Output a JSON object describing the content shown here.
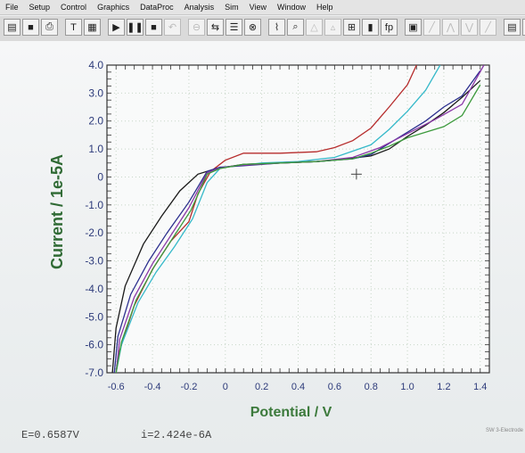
{
  "menu": [
    "File",
    "Setup",
    "Control",
    "Graphics",
    "DataProc",
    "Analysis",
    "Sim",
    "View",
    "Window",
    "Help"
  ],
  "toolbar": {
    "icons": [
      "open-icon",
      "save-icon",
      "print-icon",
      "text-icon",
      "table-icon",
      "run-icon",
      "pause-icon",
      "stop-icon",
      "reverse-icon",
      "filter-icon",
      "transfer-icon",
      "options-icon",
      "smooth-icon",
      "graph-icon",
      "zoom-icon",
      "peak-icon",
      "peak2-icon",
      "overlay-icon",
      "color-icon",
      "fp-label-icon",
      "layout-icon",
      "fit1-icon",
      "fit2-icon",
      "fit3-icon",
      "fit4-icon",
      "report-icon",
      "help-icon"
    ],
    "fp_label": "fp"
  },
  "status": {
    "potential_label": "E=0.6587V",
    "current_label": "i=2.424e-6A"
  },
  "corner_text": "SW   3-Electrode",
  "chart_data": {
    "type": "line",
    "xlabel": "Potential / V",
    "ylabel": "Current / 1e-5A",
    "xlim": [
      -0.65,
      1.45
    ],
    "ylim": [
      -7.0,
      4.0
    ],
    "xticks": [
      "-0.6",
      "-0.4",
      "-0.2",
      "0",
      "0.2",
      "0.4",
      "0.6",
      "0.8",
      "1.0",
      "1.2",
      "1.4"
    ],
    "xtick_values": [
      -0.6,
      -0.4,
      -0.2,
      0,
      0.2,
      0.4,
      0.6,
      0.8,
      1.0,
      1.2,
      1.4
    ],
    "yticks": [
      "4.0",
      "3.0",
      "2.0",
      "1.0",
      "0",
      "-1.0",
      "-2.0",
      "-3.0",
      "-4.0",
      "-5.0",
      "-6.0",
      "-7.0"
    ],
    "ytick_values": [
      4,
      3,
      2,
      1,
      0,
      -1,
      -2,
      -3,
      -4,
      -5,
      -6,
      -7
    ],
    "grid": true,
    "series": [
      {
        "color": "#1a1a1a",
        "points": [
          [
            -0.62,
            -7.0
          ],
          [
            -0.6,
            -5.4
          ],
          [
            -0.55,
            -3.9
          ],
          [
            -0.45,
            -2.4
          ],
          [
            -0.35,
            -1.4
          ],
          [
            -0.25,
            -0.5
          ],
          [
            -0.15,
            0.1
          ],
          [
            -0.05,
            0.3
          ],
          [
            0.0,
            0.35
          ],
          [
            0.1,
            0.45
          ],
          [
            0.3,
            0.5
          ],
          [
            0.5,
            0.55
          ],
          [
            0.6,
            0.6
          ],
          [
            0.8,
            0.75
          ],
          [
            0.9,
            1.0
          ],
          [
            1.0,
            1.45
          ],
          [
            1.1,
            1.85
          ],
          [
            1.2,
            2.3
          ],
          [
            1.3,
            2.85
          ],
          [
            1.4,
            3.45
          ]
        ]
      },
      {
        "color": "#b62c2c",
        "points": [
          [
            -0.6,
            -7.0
          ],
          [
            -0.58,
            -6.2
          ],
          [
            -0.5,
            -4.6
          ],
          [
            -0.4,
            -3.3
          ],
          [
            -0.3,
            -2.3
          ],
          [
            -0.2,
            -1.6
          ],
          [
            -0.15,
            -0.6
          ],
          [
            -0.08,
            0.2
          ],
          [
            0.0,
            0.6
          ],
          [
            0.1,
            0.85
          ],
          [
            0.3,
            0.85
          ],
          [
            0.5,
            0.9
          ],
          [
            0.6,
            1.05
          ],
          [
            0.7,
            1.3
          ],
          [
            0.8,
            1.75
          ],
          [
            0.9,
            2.5
          ],
          [
            1.0,
            3.3
          ],
          [
            1.05,
            4.0
          ]
        ]
      },
      {
        "color": "#35b9c9",
        "points": [
          [
            -0.6,
            -7.0
          ],
          [
            -0.57,
            -6.0
          ],
          [
            -0.48,
            -4.5
          ],
          [
            -0.38,
            -3.4
          ],
          [
            -0.28,
            -2.5
          ],
          [
            -0.18,
            -1.5
          ],
          [
            -0.1,
            -0.2
          ],
          [
            -0.03,
            0.3
          ],
          [
            0.0,
            0.35
          ],
          [
            0.2,
            0.5
          ],
          [
            0.4,
            0.55
          ],
          [
            0.6,
            0.7
          ],
          [
            0.8,
            1.15
          ],
          [
            0.9,
            1.7
          ],
          [
            1.0,
            2.35
          ],
          [
            1.1,
            3.1
          ],
          [
            1.18,
            4.0
          ]
        ]
      },
      {
        "color": "#2b2f8e",
        "points": [
          [
            -0.61,
            -7.0
          ],
          [
            -0.59,
            -5.7
          ],
          [
            -0.52,
            -4.2
          ],
          [
            -0.42,
            -3.0
          ],
          [
            -0.32,
            -2.0
          ],
          [
            -0.2,
            -0.9
          ],
          [
            -0.1,
            0.2
          ],
          [
            -0.03,
            0.35
          ],
          [
            0.1,
            0.4
          ],
          [
            0.3,
            0.5
          ],
          [
            0.5,
            0.55
          ],
          [
            0.7,
            0.65
          ],
          [
            0.8,
            0.8
          ],
          [
            0.9,
            1.2
          ],
          [
            1.0,
            1.6
          ],
          [
            1.1,
            2.0
          ],
          [
            1.2,
            2.5
          ],
          [
            1.3,
            2.9
          ],
          [
            1.4,
            3.8
          ]
        ]
      },
      {
        "color": "#8a38a8",
        "points": [
          [
            -0.6,
            -7.0
          ],
          [
            -0.58,
            -5.8
          ],
          [
            -0.5,
            -4.3
          ],
          [
            -0.4,
            -3.1
          ],
          [
            -0.3,
            -2.1
          ],
          [
            -0.2,
            -1.1
          ],
          [
            -0.1,
            0.15
          ],
          [
            -0.04,
            0.3
          ],
          [
            0.05,
            0.4
          ],
          [
            0.3,
            0.5
          ],
          [
            0.5,
            0.55
          ],
          [
            0.7,
            0.7
          ],
          [
            0.85,
            1.05
          ],
          [
            1.0,
            1.55
          ],
          [
            1.15,
            2.05
          ],
          [
            1.3,
            2.6
          ],
          [
            1.42,
            4.0
          ]
        ]
      },
      {
        "color": "#3c9a3c",
        "points": [
          [
            -0.6,
            -7.0
          ],
          [
            -0.57,
            -5.9
          ],
          [
            -0.49,
            -4.4
          ],
          [
            -0.39,
            -3.2
          ],
          [
            -0.29,
            -2.2
          ],
          [
            -0.19,
            -1.2
          ],
          [
            -0.1,
            0.1
          ],
          [
            -0.03,
            0.3
          ],
          [
            0.1,
            0.45
          ],
          [
            0.3,
            0.5
          ],
          [
            0.5,
            0.55
          ],
          [
            0.7,
            0.65
          ],
          [
            0.8,
            0.85
          ],
          [
            0.9,
            1.1
          ],
          [
            1.0,
            1.4
          ],
          [
            1.1,
            1.6
          ],
          [
            1.2,
            1.8
          ],
          [
            1.3,
            2.2
          ],
          [
            1.4,
            3.3
          ]
        ]
      }
    ]
  }
}
